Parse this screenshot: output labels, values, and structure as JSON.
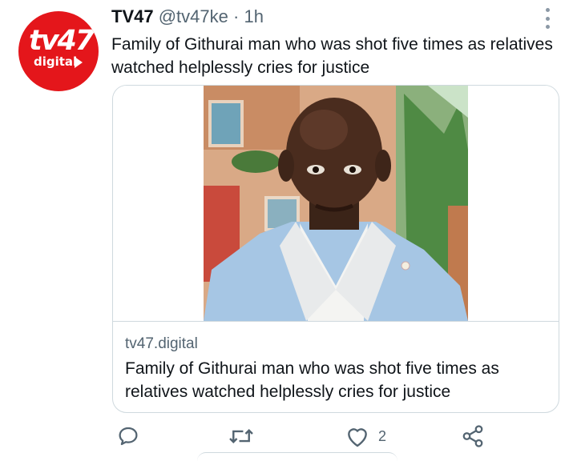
{
  "author": {
    "name": "TV47",
    "handle": "@tv47ke",
    "separator": "·",
    "time": "1h",
    "avatar_logo_main": "tv47",
    "avatar_logo_sub": "digital"
  },
  "tweet": {
    "text": "Family of Githurai man who was shot five times as relatives watched helplessly cries for justice"
  },
  "card": {
    "domain": "tv47.digital",
    "title": "Family of Githurai man who was shot five times as relatives watched helplessly cries for justice"
  },
  "actions": {
    "reply_icon": "reply-icon",
    "retweet_icon": "retweet-icon",
    "like_icon": "heart-icon",
    "like_count": "2",
    "share_icon": "share-icon"
  },
  "colors": {
    "brand_red": "#e4161b",
    "text_primary": "#0f1419",
    "text_secondary": "#536471",
    "border": "#cfd9de"
  }
}
